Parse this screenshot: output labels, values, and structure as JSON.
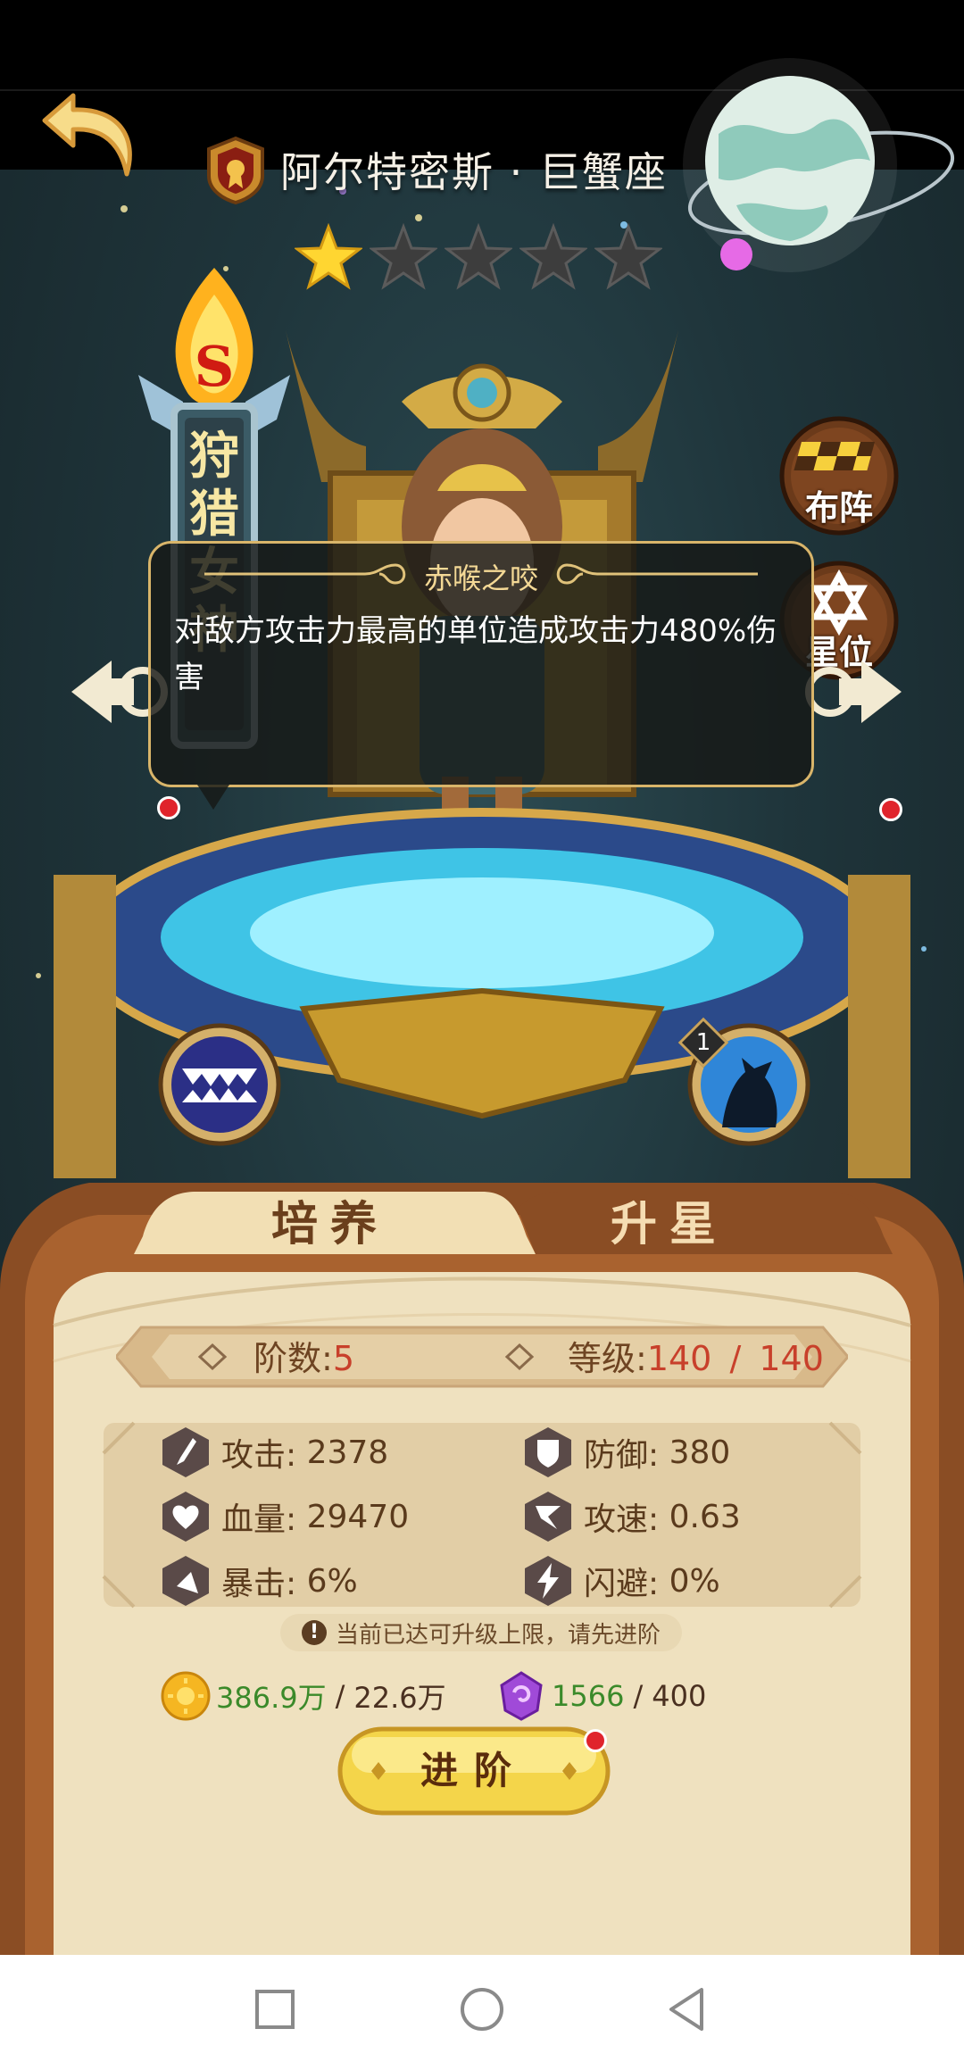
{
  "hero": {
    "name": "阿尔特密斯 · 巨蟹座",
    "star_rating": 1,
    "star_max": 5,
    "faction_grade": "S",
    "faction_title": "狩猎女神"
  },
  "side_buttons": {
    "formation": "布阵",
    "star_position": "星位"
  },
  "skill_tooltip": {
    "title": "赤喉之咬",
    "description": "对敌方攻击力最高的单位造成攻击力480%伤害"
  },
  "skills": {
    "right_skill_level": "1"
  },
  "tabs": {
    "train": "培养",
    "star_up": "升星"
  },
  "level_info": {
    "rank_label": "阶数:",
    "rank_value": "5",
    "level_label": "等级:",
    "level_current": "140",
    "level_sep": "/",
    "level_max": "140"
  },
  "stats": {
    "attack": {
      "label": "攻击:",
      "value": "2378"
    },
    "defense": {
      "label": "防御:",
      "value": "380"
    },
    "hp": {
      "label": "血量:",
      "value": "29470"
    },
    "attack_speed": {
      "label": "攻速:",
      "value": "0.63"
    },
    "crit": {
      "label": "暴击:",
      "value": "6%"
    },
    "dodge": {
      "label": "闪避:",
      "value": "0%"
    }
  },
  "notice": "当前已达可升级上限，请先进阶",
  "resources": {
    "gold": {
      "have": "386.9万",
      "sep": "/",
      "need": "22.6万"
    },
    "gem": {
      "have": "1566",
      "sep": "/",
      "need": "400"
    }
  },
  "advance_button": "进阶",
  "colors": {
    "panel_bg": "#efe1bf",
    "panel_frame": "#8a4d24",
    "accent_gold": "#f4d54a",
    "value_red": "#c8402b",
    "resource_green": "#3b8a2a"
  }
}
